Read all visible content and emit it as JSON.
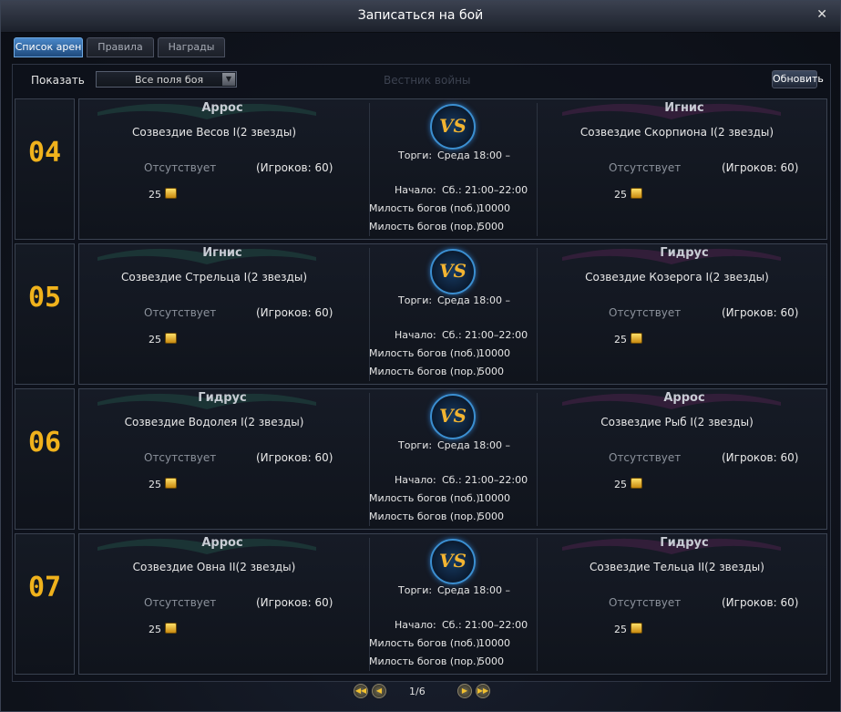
{
  "window": {
    "title": "Записаться на бой",
    "close_icon": "close-icon"
  },
  "tabs": [
    {
      "label": "Список арен",
      "active": true
    },
    {
      "label": "Правила",
      "active": false
    },
    {
      "label": "Награды",
      "active": false
    }
  ],
  "toolbar": {
    "show_label": "Показать",
    "filter_value": "Все поля боя",
    "faded_text": "Вестник войны",
    "refresh_label": "Обновить"
  },
  "colors": {
    "accent": "#4a88c9",
    "number": "#f0b21c",
    "vs_ring": "#3b8fd1",
    "vs_text": "#f2b431"
  },
  "battles": [
    {
      "number": "04",
      "left": {
        "faction": "Аррос",
        "constellation": "Созвездие Весов I(2 звезды)",
        "status": "Отсутствует",
        "players": "(Игроков: 60)",
        "reward": "25"
      },
      "center": {
        "vs": "VS",
        "bid_label": "Торги:",
        "bid_value": "Среда 18:00 –",
        "start_label": "Начало:",
        "start_value": "Сб.: 21:00–22:00",
        "favor_win_label": "Милость богов (поб.)",
        "favor_win_value": "10000",
        "favor_loss_label": "Милость богов (пор.)",
        "favor_loss_value": "5000"
      },
      "right": {
        "faction": "Игнис",
        "constellation": "Созвездие Скорпиона I(2 звезды)",
        "status": "Отсутствует",
        "players": "(Игроков: 60)",
        "reward": "25"
      }
    },
    {
      "number": "05",
      "left": {
        "faction": "Игнис",
        "constellation": "Созвездие Стрельца I(2 звезды)",
        "status": "Отсутствует",
        "players": "(Игроков: 60)",
        "reward": "25"
      },
      "center": {
        "vs": "VS",
        "bid_label": "Торги:",
        "bid_value": "Среда 18:00 –",
        "start_label": "Начало:",
        "start_value": "Сб.: 21:00–22:00",
        "favor_win_label": "Милость богов (поб.)",
        "favor_win_value": "10000",
        "favor_loss_label": "Милость богов (пор.)",
        "favor_loss_value": "5000"
      },
      "right": {
        "faction": "Гидрус",
        "constellation": "Созвездие Козерога I(2 звезды)",
        "status": "Отсутствует",
        "players": "(Игроков: 60)",
        "reward": "25"
      }
    },
    {
      "number": "06",
      "left": {
        "faction": "Гидрус",
        "constellation": "Созвездие Водолея I(2 звезды)",
        "status": "Отсутствует",
        "players": "(Игроков: 60)",
        "reward": "25"
      },
      "center": {
        "vs": "VS",
        "bid_label": "Торги:",
        "bid_value": "Среда 18:00 –",
        "start_label": "Начало:",
        "start_value": "Сб.: 21:00–22:00",
        "favor_win_label": "Милость богов (поб.)",
        "favor_win_value": "10000",
        "favor_loss_label": "Милость богов (пор.)",
        "favor_loss_value": "5000"
      },
      "right": {
        "faction": "Аррос",
        "constellation": "Созвездие Рыб I(2 звезды)",
        "status": "Отсутствует",
        "players": "(Игроков: 60)",
        "reward": "25"
      }
    },
    {
      "number": "07",
      "left": {
        "faction": "Аррос",
        "constellation": "Созвездие Овна II(2 звезды)",
        "status": "Отсутствует",
        "players": "(Игроков: 60)",
        "reward": "25"
      },
      "center": {
        "vs": "VS",
        "bid_label": "Торги:",
        "bid_value": "Среда 18:00 –",
        "start_label": "Начало:",
        "start_value": "Сб.: 21:00–22:00",
        "favor_win_label": "Милость богов (поб.)",
        "favor_win_value": "10000",
        "favor_loss_label": "Милость богов (пор.)",
        "favor_loss_value": "5000"
      },
      "right": {
        "faction": "Гидрус",
        "constellation": "Созвездие Тельца II(2 звезды)",
        "status": "Отсутствует",
        "players": "(Игроков: 60)",
        "reward": "25"
      }
    }
  ],
  "pagination": {
    "page": "1/6"
  }
}
